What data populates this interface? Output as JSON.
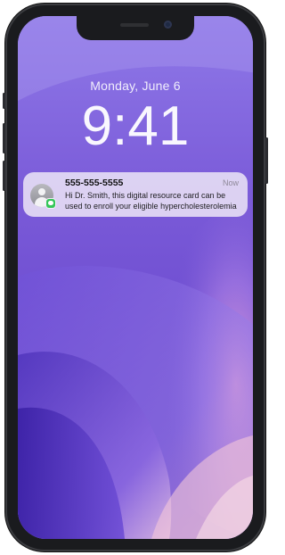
{
  "lock_screen": {
    "date": "Monday, June 6",
    "time": "9:41"
  },
  "notification": {
    "sender": "555-555-5555",
    "timestamp": "Now",
    "message_line1": "Hi Dr. Smith, this digital resource card can be",
    "message_line2": "used to enroll your eligible hypercholesterolemia",
    "icon": "contact-avatar-icon",
    "badge_icon": "messages-badge-icon"
  },
  "colors": {
    "wallpaper_primary": "#7b5cd6",
    "badge_green": "#35c759",
    "phone_frame": "#1a1b1e"
  }
}
